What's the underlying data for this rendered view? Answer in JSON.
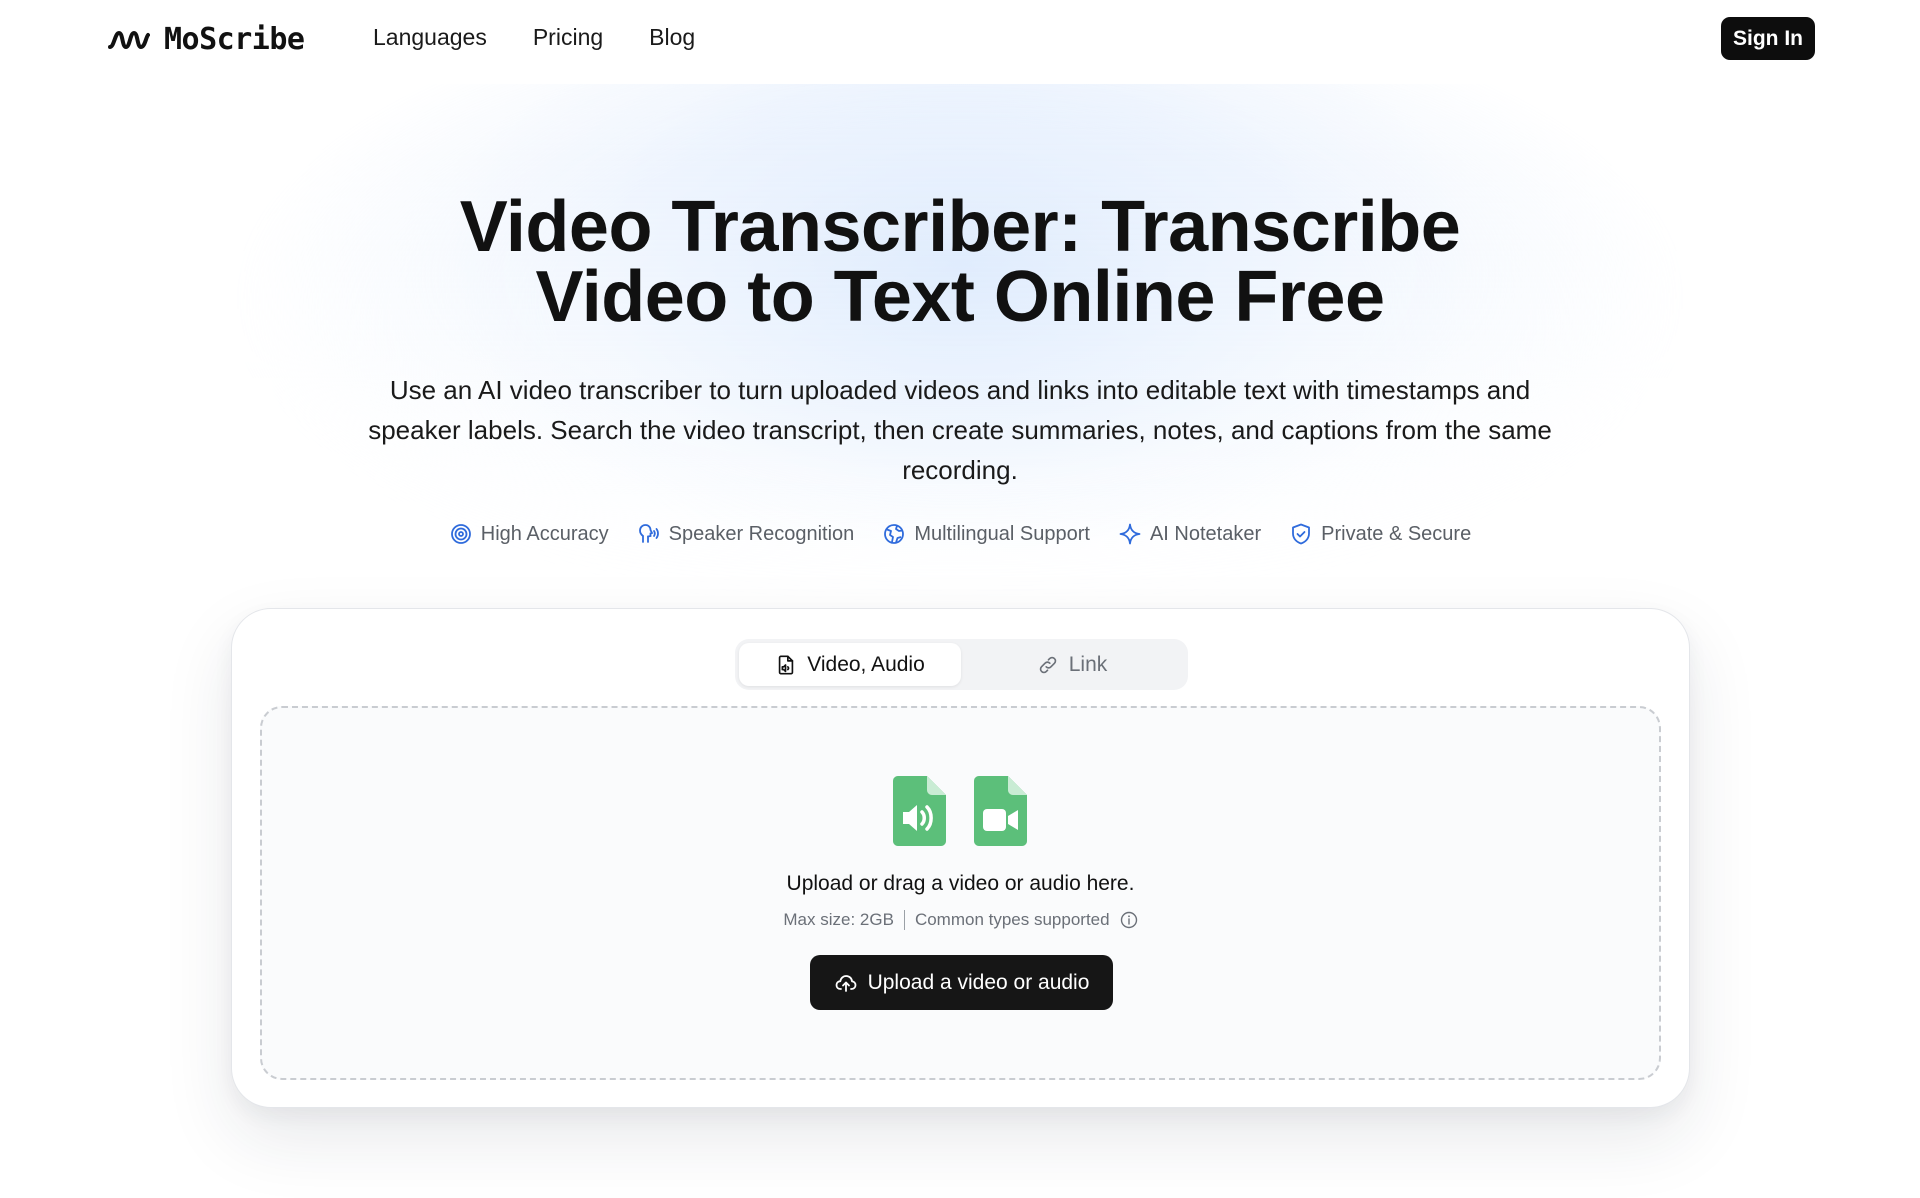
{
  "brand": {
    "name": "MoScribe",
    "logo_icon": "wave-logo-icon"
  },
  "nav": {
    "items": [
      "Languages",
      "Pricing",
      "Blog"
    ]
  },
  "header": {
    "signin_label": "Sign In"
  },
  "hero": {
    "title": "Video Transcriber: Transcribe Video to Text Online Free",
    "subtitle": "Use an AI video transcriber to turn uploaded videos and links into editable text with timestamps and speaker labels. Search the video transcript, then create summaries, notes, and captions from the same recording."
  },
  "features": [
    {
      "label": "High Accuracy",
      "icon": "target-icon"
    },
    {
      "label": "Speaker Recognition",
      "icon": "speaker-voice-icon"
    },
    {
      "label": "Multilingual Support",
      "icon": "globe-icon"
    },
    {
      "label": "AI Notetaker",
      "icon": "sparkle-icon"
    },
    {
      "label": "Private & Secure",
      "icon": "shield-check-icon"
    }
  ],
  "upload": {
    "tabs": [
      {
        "label": "Video, Audio",
        "icon": "file-audio-icon",
        "active": true
      },
      {
        "label": "Link",
        "icon": "link-icon",
        "active": false
      }
    ],
    "drop_text": "Upload or drag a video or audio here.",
    "max_size": "Max size: 2GB",
    "types_text": "Common types supported",
    "button_label": "Upload a video or audio"
  },
  "colors": {
    "accent_blue": "#2f6bdc",
    "file_green": "#5cbf7a",
    "button_dark": "#161616"
  }
}
